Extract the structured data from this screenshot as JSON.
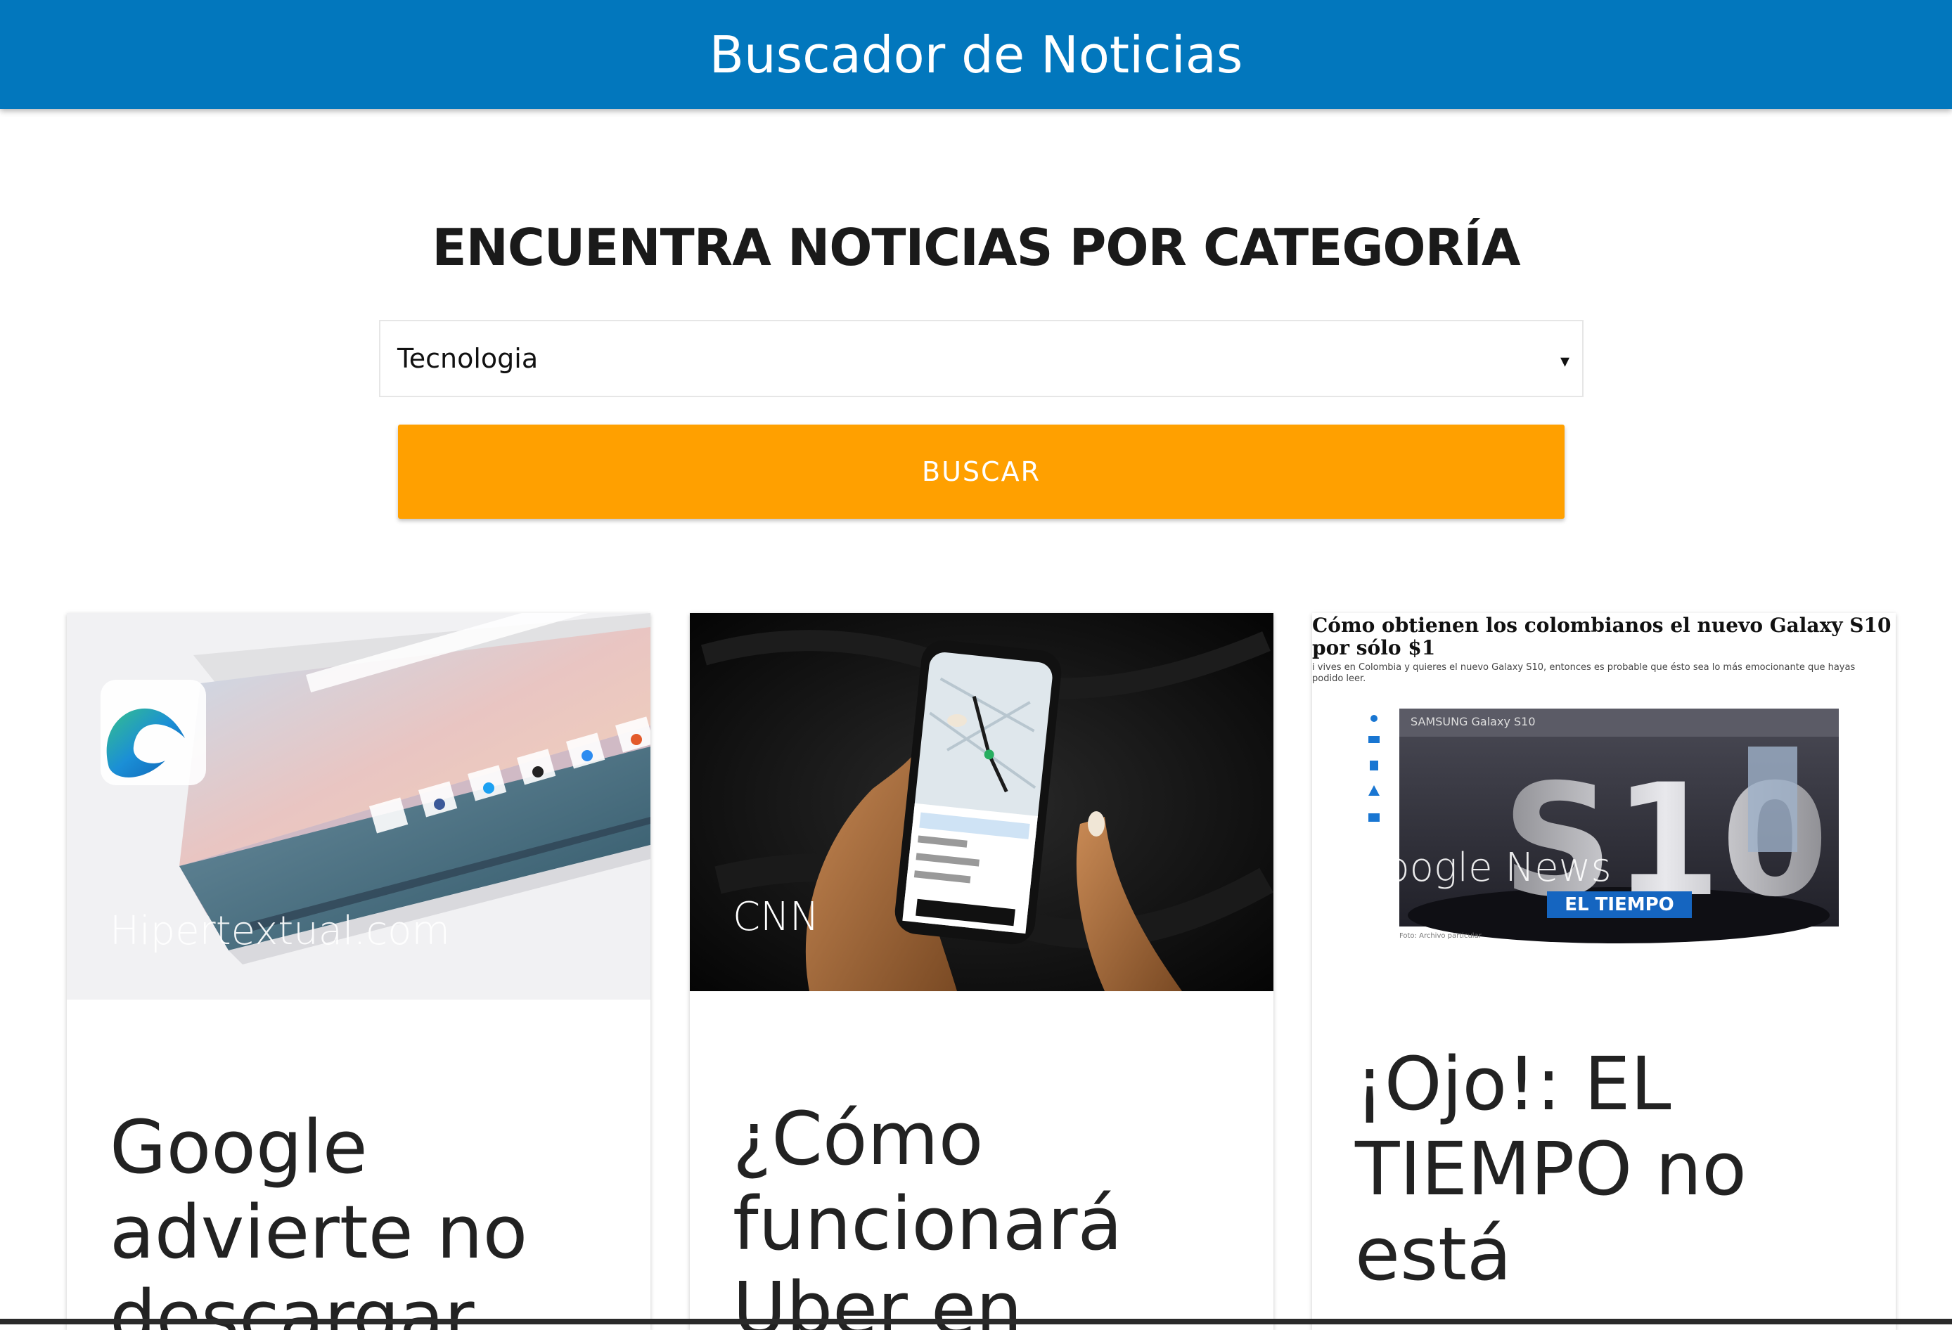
{
  "header": {
    "title": "Buscador de Noticias",
    "bg_color": "#0277bd"
  },
  "main": {
    "heading": "ENCUENTRA NOTICIAS POR CATEGORÍA",
    "category_select": {
      "selected": "Tecnologia",
      "caret": "▾"
    },
    "search_button": {
      "label": "BUSCAR",
      "color": "#ffa000"
    }
  },
  "cards": [
    {
      "source": "Hipertextual.com",
      "title": "Google advierte no descargar",
      "image_icon": "browser-screenshot-image"
    },
    {
      "source": "CNN",
      "title": "¿Cómo funcionará Uber en",
      "image_icon": "phone-map-photo"
    },
    {
      "source": "Google News",
      "title": "¡Ojo!: EL TIEMPO no está",
      "image_icon": "newspaper-clipping-image",
      "image_text": {
        "headline": "Cómo obtienen los colombianos el nuevo Galaxy S10 por sólo $1",
        "lede": "i vives en Colombia y quieres el nuevo Galaxy S10, entonces es probable que ésto sea lo más emocionante que hayas podido leer.",
        "banner": "EL TIEMPO",
        "sign": "S10",
        "store": "SAMSUNG Galaxy S10",
        "caption": "Foto: Archivo particular"
      }
    }
  ]
}
